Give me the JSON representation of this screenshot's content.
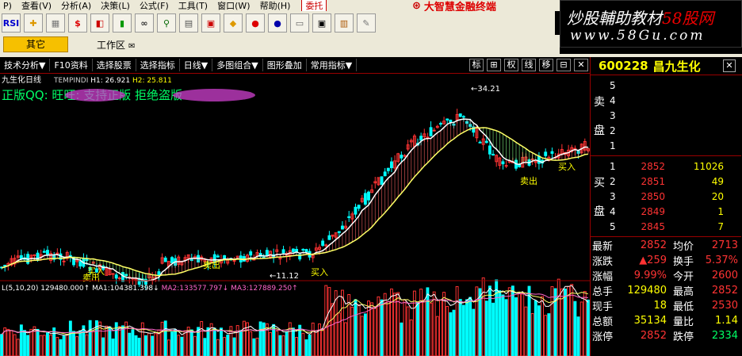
{
  "menu": {
    "items": [
      "P)",
      "查看(V)",
      "分析(A)",
      "决策(L)",
      "公式(F)",
      "工具(T)",
      "窗口(W)",
      "帮助(H)"
    ],
    "weituo": "委托",
    "banner": "大智慧金融终端"
  },
  "toolbar": {
    "icons": [
      "rsi-icon",
      "cross-icon",
      "grid-icon",
      "dollar-icon",
      "chart-icon",
      "bars-icon",
      "binoculars-icon",
      "zoom-icon",
      "calc-icon",
      "square-icon",
      "diamond-icon",
      "red-icon",
      "blue-icon",
      "tray-icon",
      "window-icon",
      "books-icon",
      "pin-icon"
    ],
    "rsi_label": "RSI",
    "dollar_label": "$"
  },
  "logo": {
    "line1_a": "炒股輔助教材",
    "line1_b": "58股网",
    "line2": "www.58Gu.com"
  },
  "tabs": {
    "active": "其它",
    "work": "工作区",
    "work_icon": "✉"
  },
  "funcbar": {
    "items": [
      "技术分析",
      "F10资料",
      "选择股票",
      "选择指标",
      "日线",
      "多图组合",
      "图形叠加",
      "常用指标"
    ],
    "right": [
      "标",
      "⊞",
      "权",
      "线",
      "移",
      "⊟",
      "✕"
    ]
  },
  "stock": {
    "code": "600228",
    "name": "昌九生化"
  },
  "chart": {
    "title_name": "九生化日线",
    "indicator": "TEMPINDI",
    "h1_label": "H1:",
    "h1_value": "26.921",
    "h2_label": "H2:",
    "h2_value": "25.811",
    "watermark": "正版QQ:        旺旺:              支持正版  拒绝盗版",
    "peak_label": "34.21",
    "low_label": "11.12",
    "buy_label": "买入",
    "sell_label": "卖出",
    "vol_header": "L(5,10,20)",
    "vol_value": "129480.000↑",
    "ma1_label": "MA1:",
    "ma1_value": "104381.398↓",
    "ma2_label": "MA2:",
    "ma2_value": "133577.797↓",
    "ma3_label": "MA3:",
    "ma3_value": "127889.250↑"
  },
  "book": {
    "sell_label_1": "卖",
    "sell_label_2": "盘",
    "buy_label_1": "买",
    "buy_label_2": "盘",
    "sell": [
      {
        "lv": "5",
        "price": "",
        "vol": ""
      },
      {
        "lv": "4",
        "price": "",
        "vol": ""
      },
      {
        "lv": "3",
        "price": "",
        "vol": ""
      },
      {
        "lv": "2",
        "price": "",
        "vol": ""
      },
      {
        "lv": "1",
        "price": "",
        "vol": ""
      }
    ],
    "buy": [
      {
        "lv": "1",
        "price": "2852",
        "vol": "11026"
      },
      {
        "lv": "2",
        "price": "2851",
        "vol": "49"
      },
      {
        "lv": "3",
        "price": "2850",
        "vol": "20"
      },
      {
        "lv": "4",
        "price": "2849",
        "vol": "1"
      },
      {
        "lv": "5",
        "price": "2845",
        "vol": "7"
      }
    ]
  },
  "stats": [
    {
      "k": "最新",
      "v": "2852",
      "k2": "均价",
      "v2": "2713"
    },
    {
      "k": "涨跌",
      "v": "▲259",
      "k2": "换手",
      "v2": "5.37%"
    },
    {
      "k": "涨幅",
      "v": "9.99%",
      "k2": "今开",
      "v2": "2600"
    },
    {
      "k": "总手",
      "v": "129480",
      "k2": "最高",
      "v2": "2852"
    },
    {
      "k": "现手",
      "v": "18",
      "k2": "最低",
      "v2": "2530"
    },
    {
      "k": "总额",
      "v": "35134",
      "k2": "量比",
      "v2": "1.14"
    },
    {
      "k": "涨停",
      "v": "2852",
      "k2": "跌停",
      "v2": "2334"
    }
  ],
  "colors": {
    "up": "#ff3333",
    "down": "#00ffff",
    "ma_white": "#ffffff",
    "ma_yellow": "#ffff66",
    "ma_pink": "#ff66cc",
    "bg": "#000000",
    "chrome": "#ece9d8",
    "quote_yellow": "#ffff00"
  }
}
